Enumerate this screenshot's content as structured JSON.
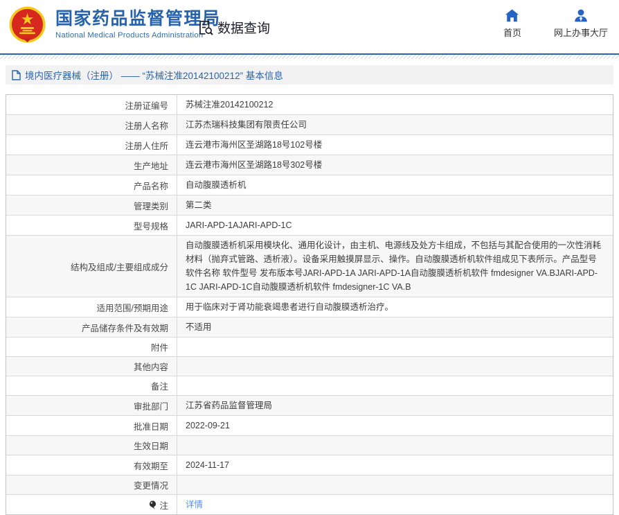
{
  "header": {
    "org_name_zh": "国家药品监督管理局",
    "org_name_en": "National Medical Products Administration",
    "emblem_icon": "china-national-emblem-icon",
    "section_label": "数据查询",
    "section_icon": "document-search-icon",
    "nav": [
      {
        "label": "首页",
        "icon": "home-icon"
      },
      {
        "label": "网上办事大厅",
        "icon": "person-icon"
      }
    ]
  },
  "breadcrumb": {
    "icon": "document-icon",
    "text": "境内医疗器械（注册） —— “苏械注准20142100212” 基本信息"
  },
  "table": {
    "rows": [
      {
        "label": "注册证编号",
        "value": "苏械注准20142100212"
      },
      {
        "label": "注册人名称",
        "value": "江苏杰瑞科技集团有限责任公司"
      },
      {
        "label": "注册人住所",
        "value": "连云港市海州区圣湖路18号102号楼"
      },
      {
        "label": "生产地址",
        "value": "连云港市海州区圣湖路18号302号楼"
      },
      {
        "label": "产品名称",
        "value": "自动腹膜透析机"
      },
      {
        "label": "管理类别",
        "value": "第二类"
      },
      {
        "label": "型号规格",
        "value": "JARI-APD-1AJARI-APD-1C"
      },
      {
        "label": "结构及组成/主要组成成分",
        "value": "自动腹膜透析机采用模块化、通用化设计，由主机、电源线及处方卡组成，不包括与其配合使用的一次性消耗材料（抛弃式管路、透析液）。设备采用触摸屏显示、操作。自动腹膜透析机软件组成见下表所示。产品型号 软件名称 软件型号 发布版本号JARI-APD-1A JARI-APD-1A自动腹膜透析机软件 fmdesigner VA.BJARI-APD-1C JARI-APD-1C自动腹膜透析机软件 fmdesigner-1C VA.B"
      },
      {
        "label": "适用范围/预期用途",
        "value": "用于临床对于肾功能衰竭患者进行自动腹膜透析治疗。"
      },
      {
        "label": "产品储存条件及有效期",
        "value": "不适用"
      },
      {
        "label": "附件",
        "value": ""
      },
      {
        "label": "其他内容",
        "value": ""
      },
      {
        "label": "备注",
        "value": ""
      },
      {
        "label": "审批部门",
        "value": "江苏省药品监督管理局"
      },
      {
        "label": "批准日期",
        "value": "2022-09-21"
      },
      {
        "label": "生效日期",
        "value": ""
      },
      {
        "label": "有效期至",
        "value": "2024-11-17"
      },
      {
        "label": "变更情况",
        "value": ""
      },
      {
        "label": "注",
        "value": "详情",
        "label_icon": "note-icon",
        "value_is_link": true
      }
    ]
  },
  "colors": {
    "brand_blue": "#2763ad",
    "nav_icon_blue": "#2563c4",
    "breadcrumb_blue": "#2965ae",
    "link_blue": "#4f8ef7",
    "emblem_red": "#d6281e",
    "emblem_gold": "#f7c81e",
    "row_alt_bg": "#f7f7f8",
    "border_gray": "#d8d8da"
  }
}
